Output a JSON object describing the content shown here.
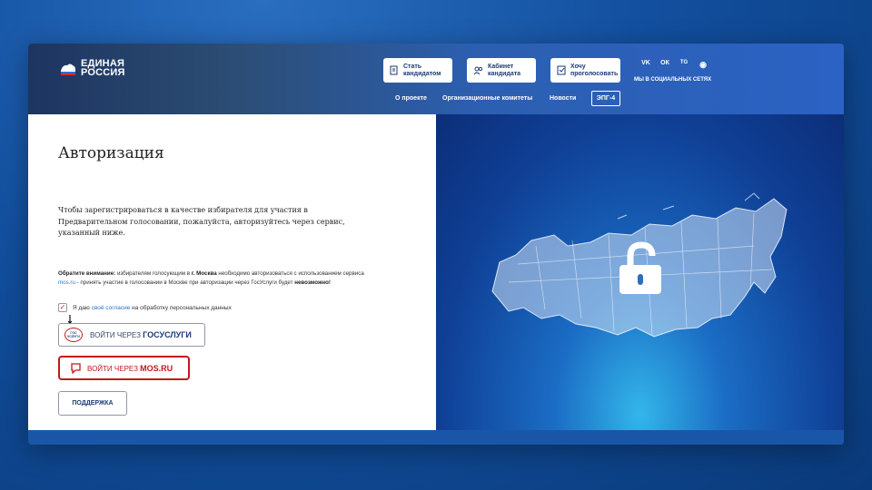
{
  "brand": {
    "line1": "ЕДИНАЯ",
    "line2": "РОССИЯ"
  },
  "header": {
    "buttons": [
      {
        "line1": "Стать",
        "line2": "кандидатом",
        "icon": "add-document-icon"
      },
      {
        "line1": "Кабинет",
        "line2": "кандидата",
        "icon": "users-icon"
      },
      {
        "line1": "Хочу",
        "line2": "проголосовать",
        "icon": "ballot-icon"
      }
    ],
    "social": {
      "vk": "VK",
      "ok": "ОК",
      "tg": "TG",
      "other": "◉",
      "label": "МЫ В СОЦИАЛЬНЫХ СЕТЯХ"
    },
    "nav": [
      "О проекте",
      "Организационные комитеты",
      "Новости",
      "ЭПГ-4"
    ]
  },
  "auth": {
    "title": "Авторизация",
    "intro": "Чтобы зарегистрироваться в качестве избирателя для участия в Предварительном голосовании, пожалуйста, авторизуйтесь через сервис, указанный ниже.",
    "notice": {
      "bold": "Обратите внимание:",
      "part1": " избирателям голосующим в ",
      "city": "г. Москва",
      "part2": " необходимо авторизоваться с использованием сервиса ",
      "link": "mos.ru",
      "part3": " - принять участие в голосовании в Москве при авторизации через ГосУслуги будет ",
      "emph": "невозможно!"
    },
    "consent": {
      "before": "Я даю ",
      "link": "своё согласие",
      "after": " на обработку персональных данных",
      "checked": true
    },
    "gosuslugi": {
      "prefix": "ВОЙТИ ЧЕРЕЗ ",
      "name": "ГОСУСЛУГИ",
      "logo": "ГОС УСЛУГИ"
    },
    "mosru": {
      "prefix": "ВОЙТИ ЧЕРЕЗ ",
      "name": "MOS.RU"
    },
    "support": "ПОДДЕРЖКА"
  },
  "colors": {
    "accent": "#c4161c",
    "brand_blue": "#1b3a7a",
    "link": "#2a74c9"
  }
}
